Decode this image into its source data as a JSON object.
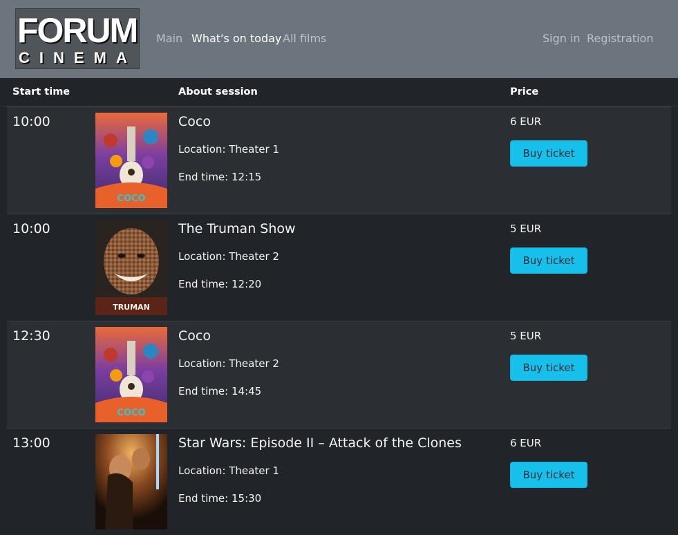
{
  "logo": {
    "line1": "FORUM",
    "line2": "CINEMA"
  },
  "nav": {
    "main": "Main",
    "whats_on": "What's on today",
    "all_films": "All films",
    "sign_in": "Sign in",
    "registration": "Registration"
  },
  "table": {
    "headers": {
      "start_time": "Start time",
      "about": "About session",
      "price": "Price"
    },
    "rows": [
      {
        "time": "10:00",
        "title": "Coco",
        "location": "Location: Theater 1",
        "end": "End time: 12:15",
        "price": "6 EUR",
        "button": "Buy ticket",
        "poster": "coco-poster"
      },
      {
        "time": "10:00",
        "title": "The Truman Show",
        "location": "Location: Theater 2",
        "end": "End time: 12:20",
        "price": "5 EUR",
        "button": "Buy ticket",
        "poster": "truman-show-poster"
      },
      {
        "time": "12:30",
        "title": "Coco",
        "location": "Location: Theater 2",
        "end": "End time: 14:45",
        "price": "5 EUR",
        "button": "Buy ticket",
        "poster": "coco-poster"
      },
      {
        "time": "13:00",
        "title": "Star Wars: Episode II – Attack of the Clones",
        "location": "Location: Theater 1",
        "end": "End time: 15:30",
        "price": "6 EUR",
        "button": "Buy ticket",
        "poster": "star-wars-poster"
      }
    ]
  },
  "poster_texts": {
    "coco": "COCO",
    "truman": "TRUMAN"
  },
  "colors": {
    "navbar": "#6c757d",
    "body": "#212429",
    "stripe": "#2b2f34",
    "button": "#17c0eb"
  }
}
